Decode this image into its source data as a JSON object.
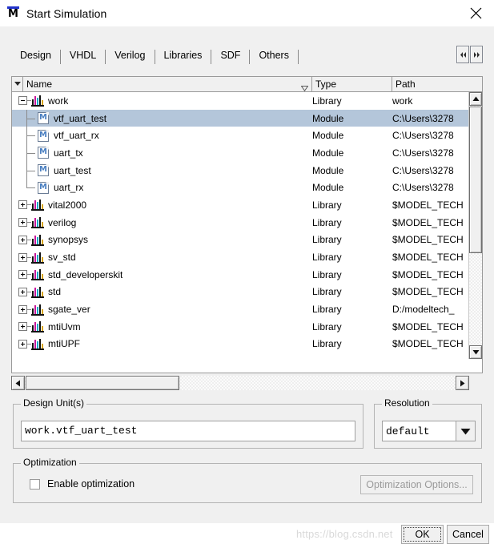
{
  "window": {
    "title": "Start Simulation",
    "icon": "modelsim-m-icon",
    "close_label": "✕"
  },
  "tabs": [
    {
      "label": "Design",
      "active": true
    },
    {
      "label": "VHDL",
      "active": false
    },
    {
      "label": "Verilog",
      "active": false
    },
    {
      "label": "Libraries",
      "active": false
    },
    {
      "label": "SDF",
      "active": false
    },
    {
      "label": "Others",
      "active": false
    }
  ],
  "tab_scroll": {
    "left_icon": "chevron-left-icon",
    "right_icon": "chevron-right-icon"
  },
  "tree": {
    "columns": [
      "Name",
      "Type",
      "Path"
    ],
    "sort_indicator": "▽",
    "corner_icon": "▼",
    "rows": [
      {
        "name": "work",
        "type": "Library",
        "path": "work",
        "level": 0,
        "icon": "library-icon",
        "expander": "minus",
        "selected": false,
        "last": false
      },
      {
        "name": "vtf_uart_test",
        "type": "Module",
        "path": "C:\\Users\\3278",
        "level": 1,
        "icon": "module-icon",
        "expander": "none",
        "selected": true,
        "last": false
      },
      {
        "name": "vtf_uart_rx",
        "type": "Module",
        "path": "C:\\Users\\3278",
        "level": 1,
        "icon": "module-icon",
        "expander": "none",
        "selected": false,
        "last": false
      },
      {
        "name": "uart_tx",
        "type": "Module",
        "path": "C:\\Users\\3278",
        "level": 1,
        "icon": "module-icon",
        "expander": "none",
        "selected": false,
        "last": false
      },
      {
        "name": "uart_test",
        "type": "Module",
        "path": "C:\\Users\\3278",
        "level": 1,
        "icon": "module-icon",
        "expander": "none",
        "selected": false,
        "last": false
      },
      {
        "name": "uart_rx",
        "type": "Module",
        "path": "C:\\Users\\3278",
        "level": 1,
        "icon": "module-icon",
        "expander": "none",
        "selected": false,
        "last": true
      },
      {
        "name": "vital2000",
        "type": "Library",
        "path": "$MODEL_TECH",
        "level": 0,
        "icon": "library-icon",
        "expander": "plus",
        "selected": false,
        "last": false
      },
      {
        "name": "verilog",
        "type": "Library",
        "path": "$MODEL_TECH",
        "level": 0,
        "icon": "library-icon",
        "expander": "plus",
        "selected": false,
        "last": false
      },
      {
        "name": "synopsys",
        "type": "Library",
        "path": "$MODEL_TECH",
        "level": 0,
        "icon": "library-icon",
        "expander": "plus",
        "selected": false,
        "last": false
      },
      {
        "name": "sv_std",
        "type": "Library",
        "path": "$MODEL_TECH",
        "level": 0,
        "icon": "library-icon",
        "expander": "plus",
        "selected": false,
        "last": false
      },
      {
        "name": "std_developerskit",
        "type": "Library",
        "path": "$MODEL_TECH",
        "level": 0,
        "icon": "library-icon",
        "expander": "plus",
        "selected": false,
        "last": false
      },
      {
        "name": "std",
        "type": "Library",
        "path": "$MODEL_TECH",
        "level": 0,
        "icon": "library-icon",
        "expander": "plus",
        "selected": false,
        "last": false
      },
      {
        "name": "sgate_ver",
        "type": "Library",
        "path": "D:/modeltech_",
        "level": 0,
        "icon": "library-icon",
        "expander": "plus",
        "selected": false,
        "last": false
      },
      {
        "name": "mtiUvm",
        "type": "Library",
        "path": "$MODEL_TECH",
        "level": 0,
        "icon": "library-icon",
        "expander": "plus",
        "selected": false,
        "last": false
      },
      {
        "name": "mtiUPF",
        "type": "Library",
        "path": "$MODEL_TECH",
        "level": 0,
        "icon": "library-icon",
        "expander": "plus",
        "selected": false,
        "last": false
      }
    ]
  },
  "scrollbars": {
    "vertical": {
      "up_icon": "▲",
      "down_icon": "▼"
    },
    "horizontal": {
      "left_icon": "◀",
      "right_icon": "▶"
    }
  },
  "design_units": {
    "title": "Design Unit(s)",
    "value": "work.vtf_uart_test"
  },
  "resolution": {
    "title": "Resolution",
    "value": "default",
    "arrow_icon": "▼"
  },
  "optimization": {
    "title": "Optimization",
    "enable_label": "Enable optimization",
    "enabled": false,
    "options_button": "Optimization Options..."
  },
  "footer": {
    "ok_label": "OK",
    "cancel_label": "Cancel"
  },
  "watermark": {
    "text": "https://blog.csdn.net"
  },
  "colors": {
    "selection": "#b4c6da",
    "dialog_bg": "#f0f0f0",
    "list_bg": "#ffffff",
    "border": "#9a9a9a",
    "disabled_text": "#9a9a9a",
    "watermark": "#d9d9d9"
  }
}
